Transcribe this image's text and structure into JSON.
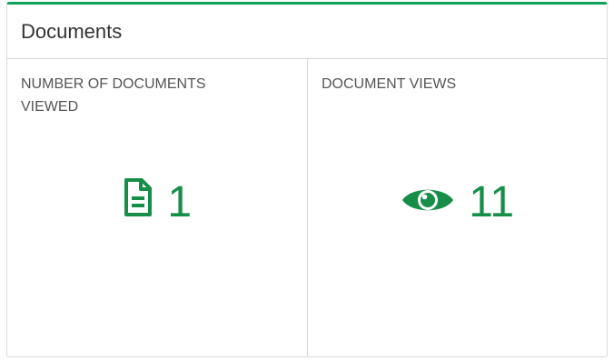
{
  "panel": {
    "title": "Documents",
    "accent_color": "#12a35a"
  },
  "stats": [
    {
      "label": "NUMBER OF DOCUMENTS VIEWED",
      "value": "1",
      "icon": "document-icon",
      "color": "#168e48"
    },
    {
      "label": "DOCUMENT VIEWS",
      "value": "11",
      "icon": "eye-icon",
      "color": "#168e48"
    }
  ]
}
